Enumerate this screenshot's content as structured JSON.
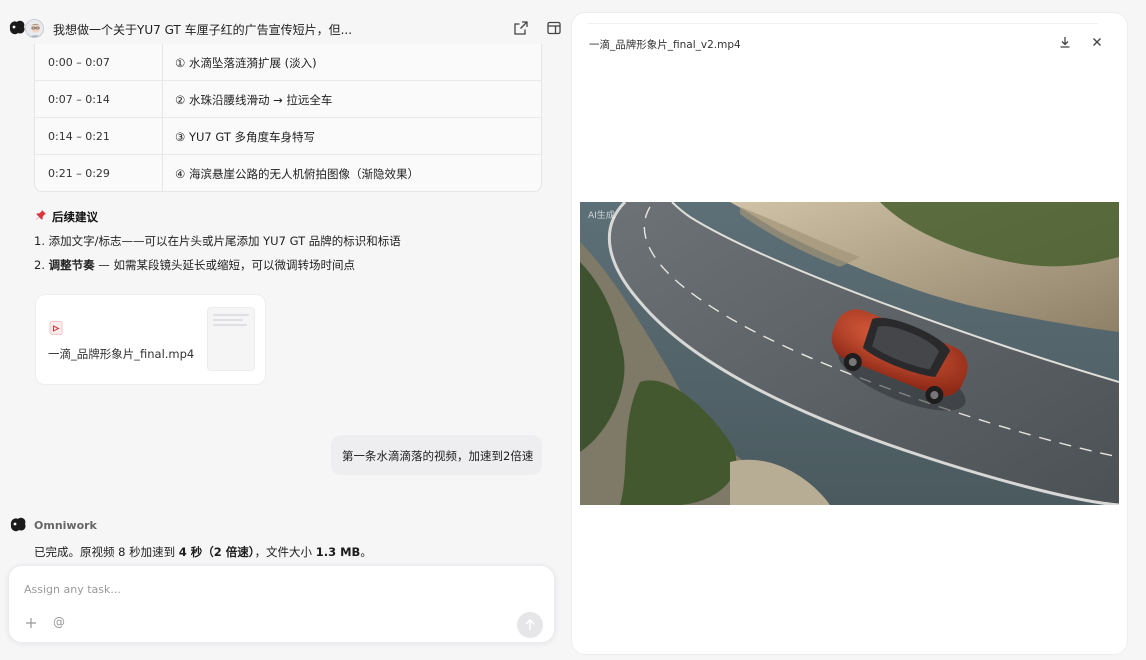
{
  "header": {
    "title": "我想做一个关于YU7 GT 车厘子红的广告宣传短片，但..."
  },
  "schedule": [
    {
      "time": "0:00 – 0:07",
      "desc": "① 水滴坠落涟漪扩展 (淡入)"
    },
    {
      "time": "0:07 – 0:14",
      "desc": "② 水珠沿腰线滑动 → 拉远全车"
    },
    {
      "time": "0:14 – 0:21",
      "desc": "③ YU7 GT 多角度车身特写"
    },
    {
      "time": "0:21 – 0:29",
      "desc": "④ 海滨悬崖公路的无人机俯拍图像（渐隐效果）"
    }
  ],
  "followup": {
    "title": "后续建议",
    "item1": "1. 添加文字/标志——可以在片头或片尾添加 YU7 GT 品牌的标识和标语",
    "item2_num": "2. ",
    "item2_bold": "调整节奏",
    "item2_rest": " — 如需某段镜头延长或缩短，可以微调转场时间点"
  },
  "file_card": {
    "name": "一滴_品牌形象片_final.mp4"
  },
  "user_message": "第一条水滴滴落的视频，加速到2倍速",
  "bot": {
    "name": "Omniwork",
    "msg_a": "已完成。原视频 8 秒加速到 ",
    "msg_b": "4 秒（2 倍速）",
    "msg_c": "，文件大小 ",
    "msg_d": "1.3 MB",
    "msg_e": "。"
  },
  "composer": {
    "placeholder": "Assign any task...",
    "at": "@"
  },
  "preview": {
    "filename": "一滴_品牌形象片_final_v2.mp4",
    "watermark": "AI生成"
  },
  "colors": {
    "car_red": "#c9432a",
    "accent_pin": "#d9363e"
  }
}
